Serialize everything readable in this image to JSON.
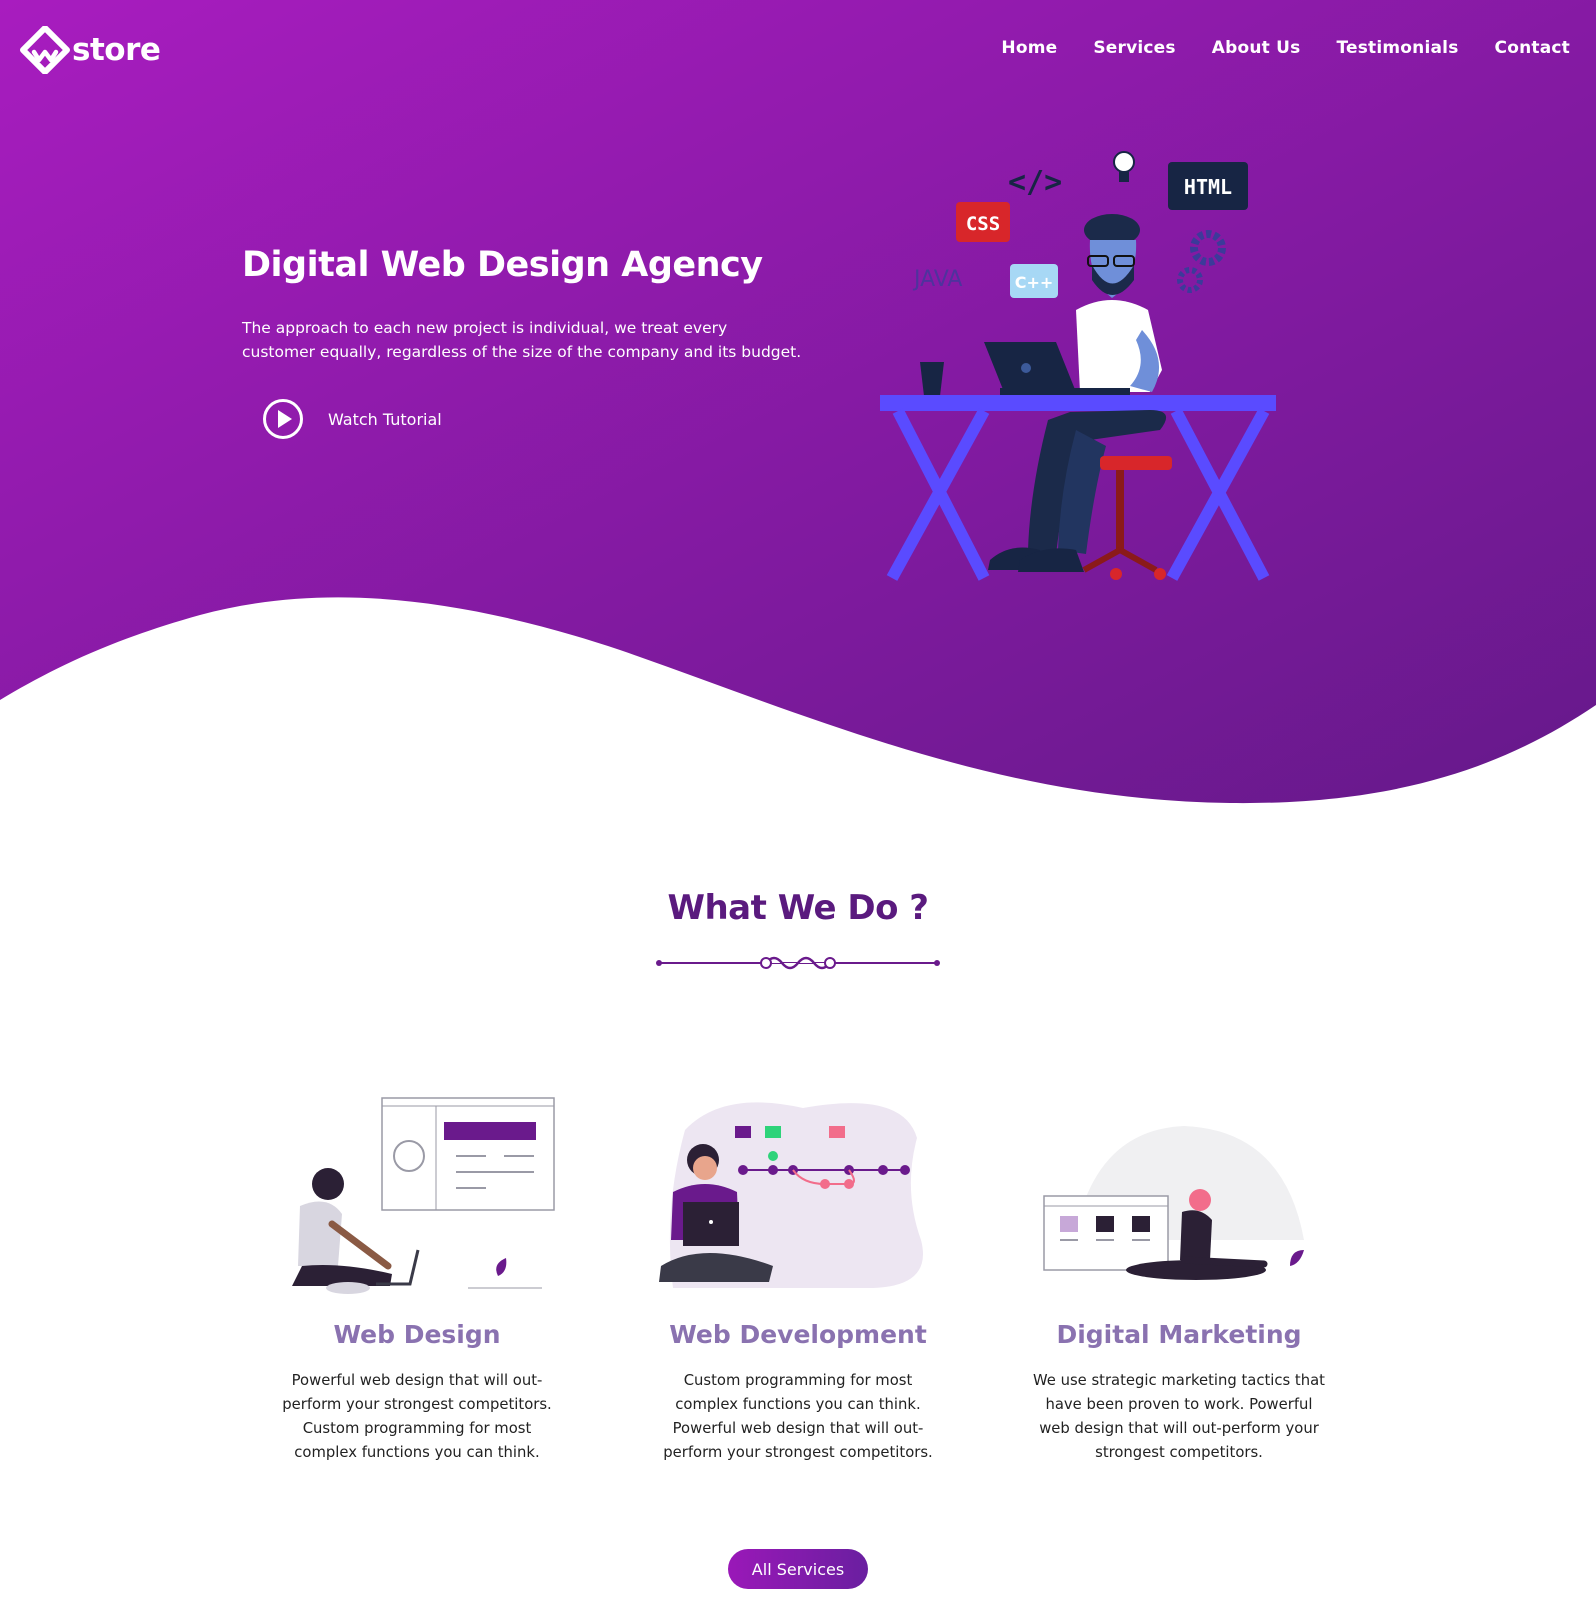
{
  "brand": {
    "name": "store"
  },
  "nav": {
    "items": [
      "Home",
      "Services",
      "About Us",
      "Testimonials",
      "Contact"
    ]
  },
  "hero": {
    "title": "Digital Web Design Agency",
    "description": "The approach to each new project is individual, we treat every customer equally, regardless of the size of the company and its budget.",
    "cta_label": "Watch Tutorial",
    "illustration_tags": [
      "CSS",
      "HTML",
      "JAVA",
      "C++",
      "</>"
    ]
  },
  "services": {
    "title": "What We Do ?",
    "items": [
      {
        "title": "Web Design",
        "description": "Powerful web design that will out-perform your strongest competitors. Custom programming for most complex functions you can think."
      },
      {
        "title": "Web Development",
        "description": "Custom programming for most complex functions you can think. Powerful web design that will out-perform your strongest competitors."
      },
      {
        "title": "Digital Marketing",
        "description": "We use strategic marketing tactics that have been proven to work. Powerful web design that will out-perform your strongest competitors."
      }
    ],
    "button_label": "All Services"
  },
  "colors": {
    "gradient_start": "#a81cbf",
    "gradient_end": "#6a1a8c",
    "heading": "#5a1a7e",
    "card_title": "#8a72b0",
    "desk": "#5a4bff"
  }
}
